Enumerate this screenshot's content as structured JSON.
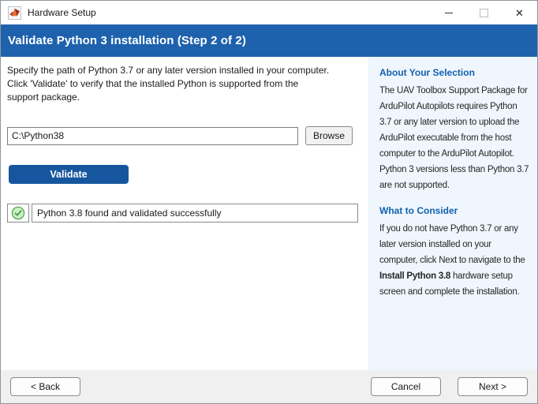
{
  "window": {
    "title": "Hardware Setup",
    "icons": {
      "app_icon": "matlab-logo",
      "minimize_icon": "horizontal-bar",
      "maximize_icon": "outline-square-disabled",
      "close_icon": "x-mark"
    },
    "close_glyph": "✕"
  },
  "header": {
    "title": "Validate Python 3 installation (Step 2 of 2)"
  },
  "main": {
    "instructions": "Specify the path of Python 3.7 or any later version installed in your computer.\nClick 'Validate' to verify that the installed Python is supported from the\nsupport package.",
    "path_value": "C:\\Python38",
    "browse_label": "Browse",
    "validate_label": "Validate",
    "validation": {
      "status_icon": "green-check-circle",
      "message": "Python 3.8 found and validated successfully"
    }
  },
  "sidebar": {
    "about": {
      "heading": "About Your Selection",
      "body": "The UAV Toolbox Support Package for ArduPilot Autopilots requires Python 3.7 or any later version to upload the ArduPilot executable from the host computer to the ArduPilot Autopilot. Python 3 versions less than Python 3.7 are not supported."
    },
    "consider": {
      "heading": "What to Consider",
      "body_before": "If you do not have Python 3.7 or any later version installed on your computer, click Next to navigate to the ",
      "body_bold": "Install Python 3.8",
      "body_after": " hardware setup screen and complete the installation."
    }
  },
  "footer": {
    "back_label": "< Back",
    "cancel_label": "Cancel",
    "next_label": "Next >"
  },
  "colors": {
    "header_blue": "#1e62ad",
    "validate_button_blue": "#16569f",
    "sidebar_bg": "#eff6fd",
    "sidebar_heading_blue": "#1262ae",
    "success_green": "#4a9e4a"
  }
}
